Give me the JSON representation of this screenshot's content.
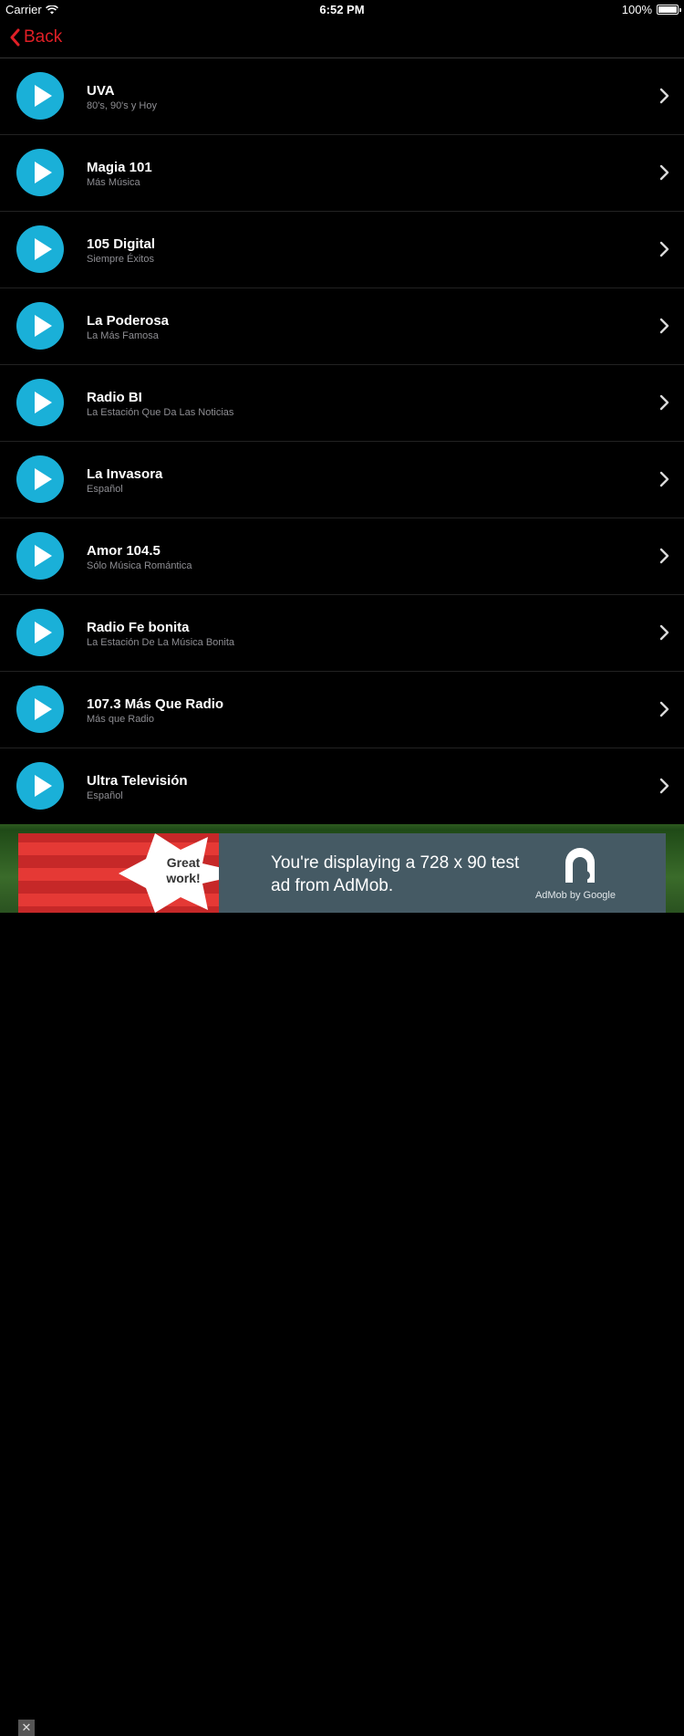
{
  "status_bar": {
    "carrier": "Carrier",
    "time": "6:52 PM",
    "battery": "100%"
  },
  "nav": {
    "back_label": "Back"
  },
  "colors": {
    "accent": "#e01f26",
    "play": "#1ab0d8",
    "background": "#000000"
  },
  "stations": [
    {
      "name": "UVA",
      "subtitle": "80's, 90's y Hoy"
    },
    {
      "name": "Magia 101",
      "subtitle": "Más Música"
    },
    {
      "name": "105 Digital",
      "subtitle": "Siempre Éxitos"
    },
    {
      "name": "La Poderosa",
      "subtitle": "La Más Famosa"
    },
    {
      "name": "Radio BI",
      "subtitle": "La Estación Que Da Las Noticias"
    },
    {
      "name": "La Invasora",
      "subtitle": "Español"
    },
    {
      "name": "Amor 104.5",
      "subtitle": "Sólo Música Romántica"
    },
    {
      "name": "Radio Fe bonita",
      "subtitle": "La Estación De La Música Bonita"
    },
    {
      "name": "107.3 Más Que Radio",
      "subtitle": "Más que Radio"
    },
    {
      "name": "Ultra Televisión",
      "subtitle": "Español"
    }
  ],
  "ad": {
    "badge_text": "Great work!",
    "message": "You're displaying a 728 x 90 test ad from AdMob.",
    "caption": "AdMob by Google",
    "close_label": "✕"
  }
}
